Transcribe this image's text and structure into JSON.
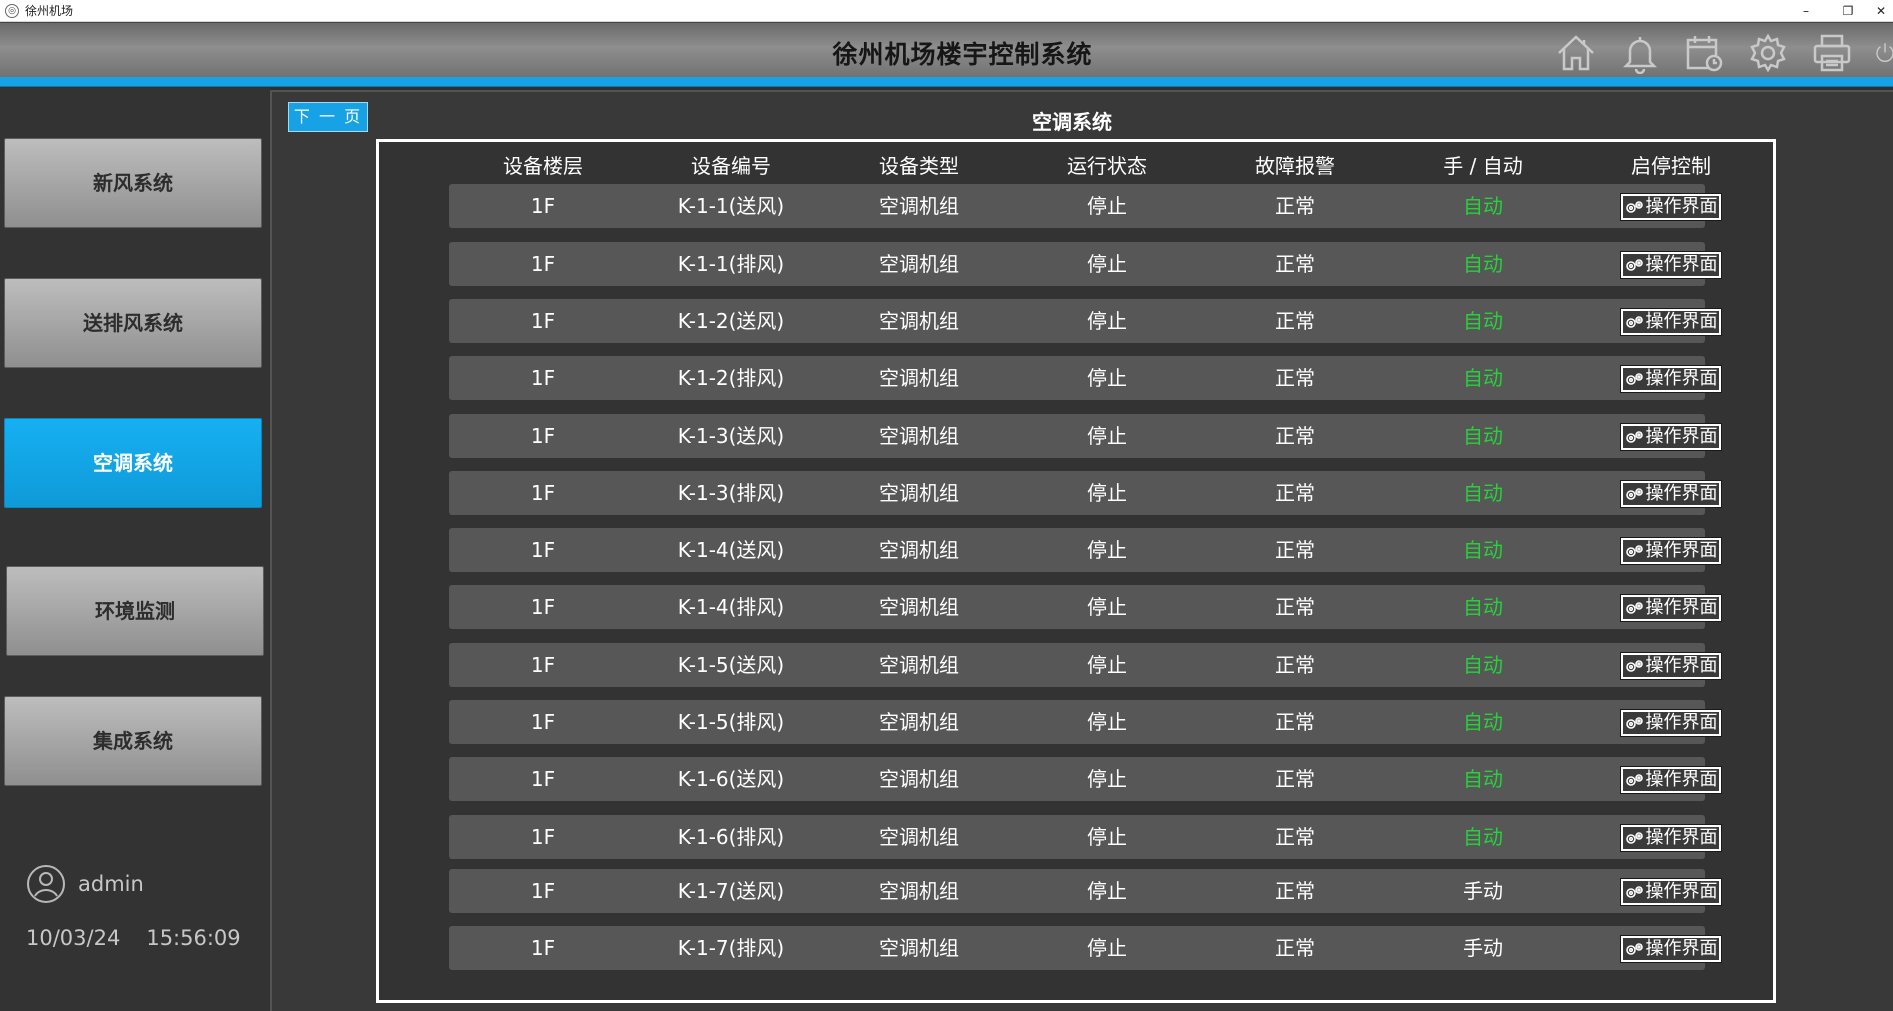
{
  "window": {
    "title": "徐州机场",
    "app_icon": "app-logo-icon",
    "minimize_glyph": "–",
    "restore_glyph": "❐",
    "close_glyph": "✕"
  },
  "header": {
    "title": "徐州机场楼宇控制系统",
    "icons": [
      "home-icon",
      "bell-icon",
      "calendar-icon",
      "gear-icon",
      "printer-icon",
      "power-icon"
    ]
  },
  "colors": {
    "accent": "#16a2e4",
    "auto": "#28d03c",
    "row_bg": "#575757"
  },
  "sidebar": {
    "items": [
      {
        "label": "新风系统",
        "active": false
      },
      {
        "label": "送排风系统",
        "active": false
      },
      {
        "label": "空调系统",
        "active": true
      },
      {
        "label": "环境监测",
        "active": false
      },
      {
        "label": "集成系统",
        "active": false
      }
    ],
    "user": "admin",
    "date": "10/03/24",
    "time": "15:56:09"
  },
  "main": {
    "next_page_label": "下 一 页",
    "title": "空调系统",
    "columns": [
      "设备楼层",
      "设备编号",
      "设备类型",
      "运行状态",
      "故障报警",
      "手 / 自动",
      "启停控制"
    ],
    "rows": [
      {
        "floor": "1F",
        "id": "K-1-1(送风)",
        "type": "空调机组",
        "status": "停止",
        "alarm": "正常",
        "mode": "自动",
        "control": "操作界面"
      },
      {
        "floor": "1F",
        "id": "K-1-1(排风)",
        "type": "空调机组",
        "status": "停止",
        "alarm": "正常",
        "mode": "自动",
        "control": "操作界面"
      },
      {
        "floor": "1F",
        "id": "K-1-2(送风)",
        "type": "空调机组",
        "status": "停止",
        "alarm": "正常",
        "mode": "自动",
        "control": "操作界面"
      },
      {
        "floor": "1F",
        "id": "K-1-2(排风)",
        "type": "空调机组",
        "status": "停止",
        "alarm": "正常",
        "mode": "自动",
        "control": "操作界面"
      },
      {
        "floor": "1F",
        "id": "K-1-3(送风)",
        "type": "空调机组",
        "status": "停止",
        "alarm": "正常",
        "mode": "自动",
        "control": "操作界面"
      },
      {
        "floor": "1F",
        "id": "K-1-3(排风)",
        "type": "空调机组",
        "status": "停止",
        "alarm": "正常",
        "mode": "自动",
        "control": "操作界面"
      },
      {
        "floor": "1F",
        "id": "K-1-4(送风)",
        "type": "空调机组",
        "status": "停止",
        "alarm": "正常",
        "mode": "自动",
        "control": "操作界面"
      },
      {
        "floor": "1F",
        "id": "K-1-4(排风)",
        "type": "空调机组",
        "status": "停止",
        "alarm": "正常",
        "mode": "自动",
        "control": "操作界面"
      },
      {
        "floor": "1F",
        "id": "K-1-5(送风)",
        "type": "空调机组",
        "status": "停止",
        "alarm": "正常",
        "mode": "自动",
        "control": "操作界面"
      },
      {
        "floor": "1F",
        "id": "K-1-5(排风)",
        "type": "空调机组",
        "status": "停止",
        "alarm": "正常",
        "mode": "自动",
        "control": "操作界面"
      },
      {
        "floor": "1F",
        "id": "K-1-6(送风)",
        "type": "空调机组",
        "status": "停止",
        "alarm": "正常",
        "mode": "自动",
        "control": "操作界面"
      },
      {
        "floor": "1F",
        "id": "K-1-6(排风)",
        "type": "空调机组",
        "status": "停止",
        "alarm": "正常",
        "mode": "自动",
        "control": "操作界面"
      },
      {
        "floor": "1F",
        "id": "K-1-7(送风)",
        "type": "空调机组",
        "status": "停止",
        "alarm": "正常",
        "mode": "手动",
        "control": "操作界面"
      },
      {
        "floor": "1F",
        "id": "K-1-7(排风)",
        "type": "空调机组",
        "status": "停止",
        "alarm": "正常",
        "mode": "手动",
        "control": "操作界面"
      }
    ]
  }
}
